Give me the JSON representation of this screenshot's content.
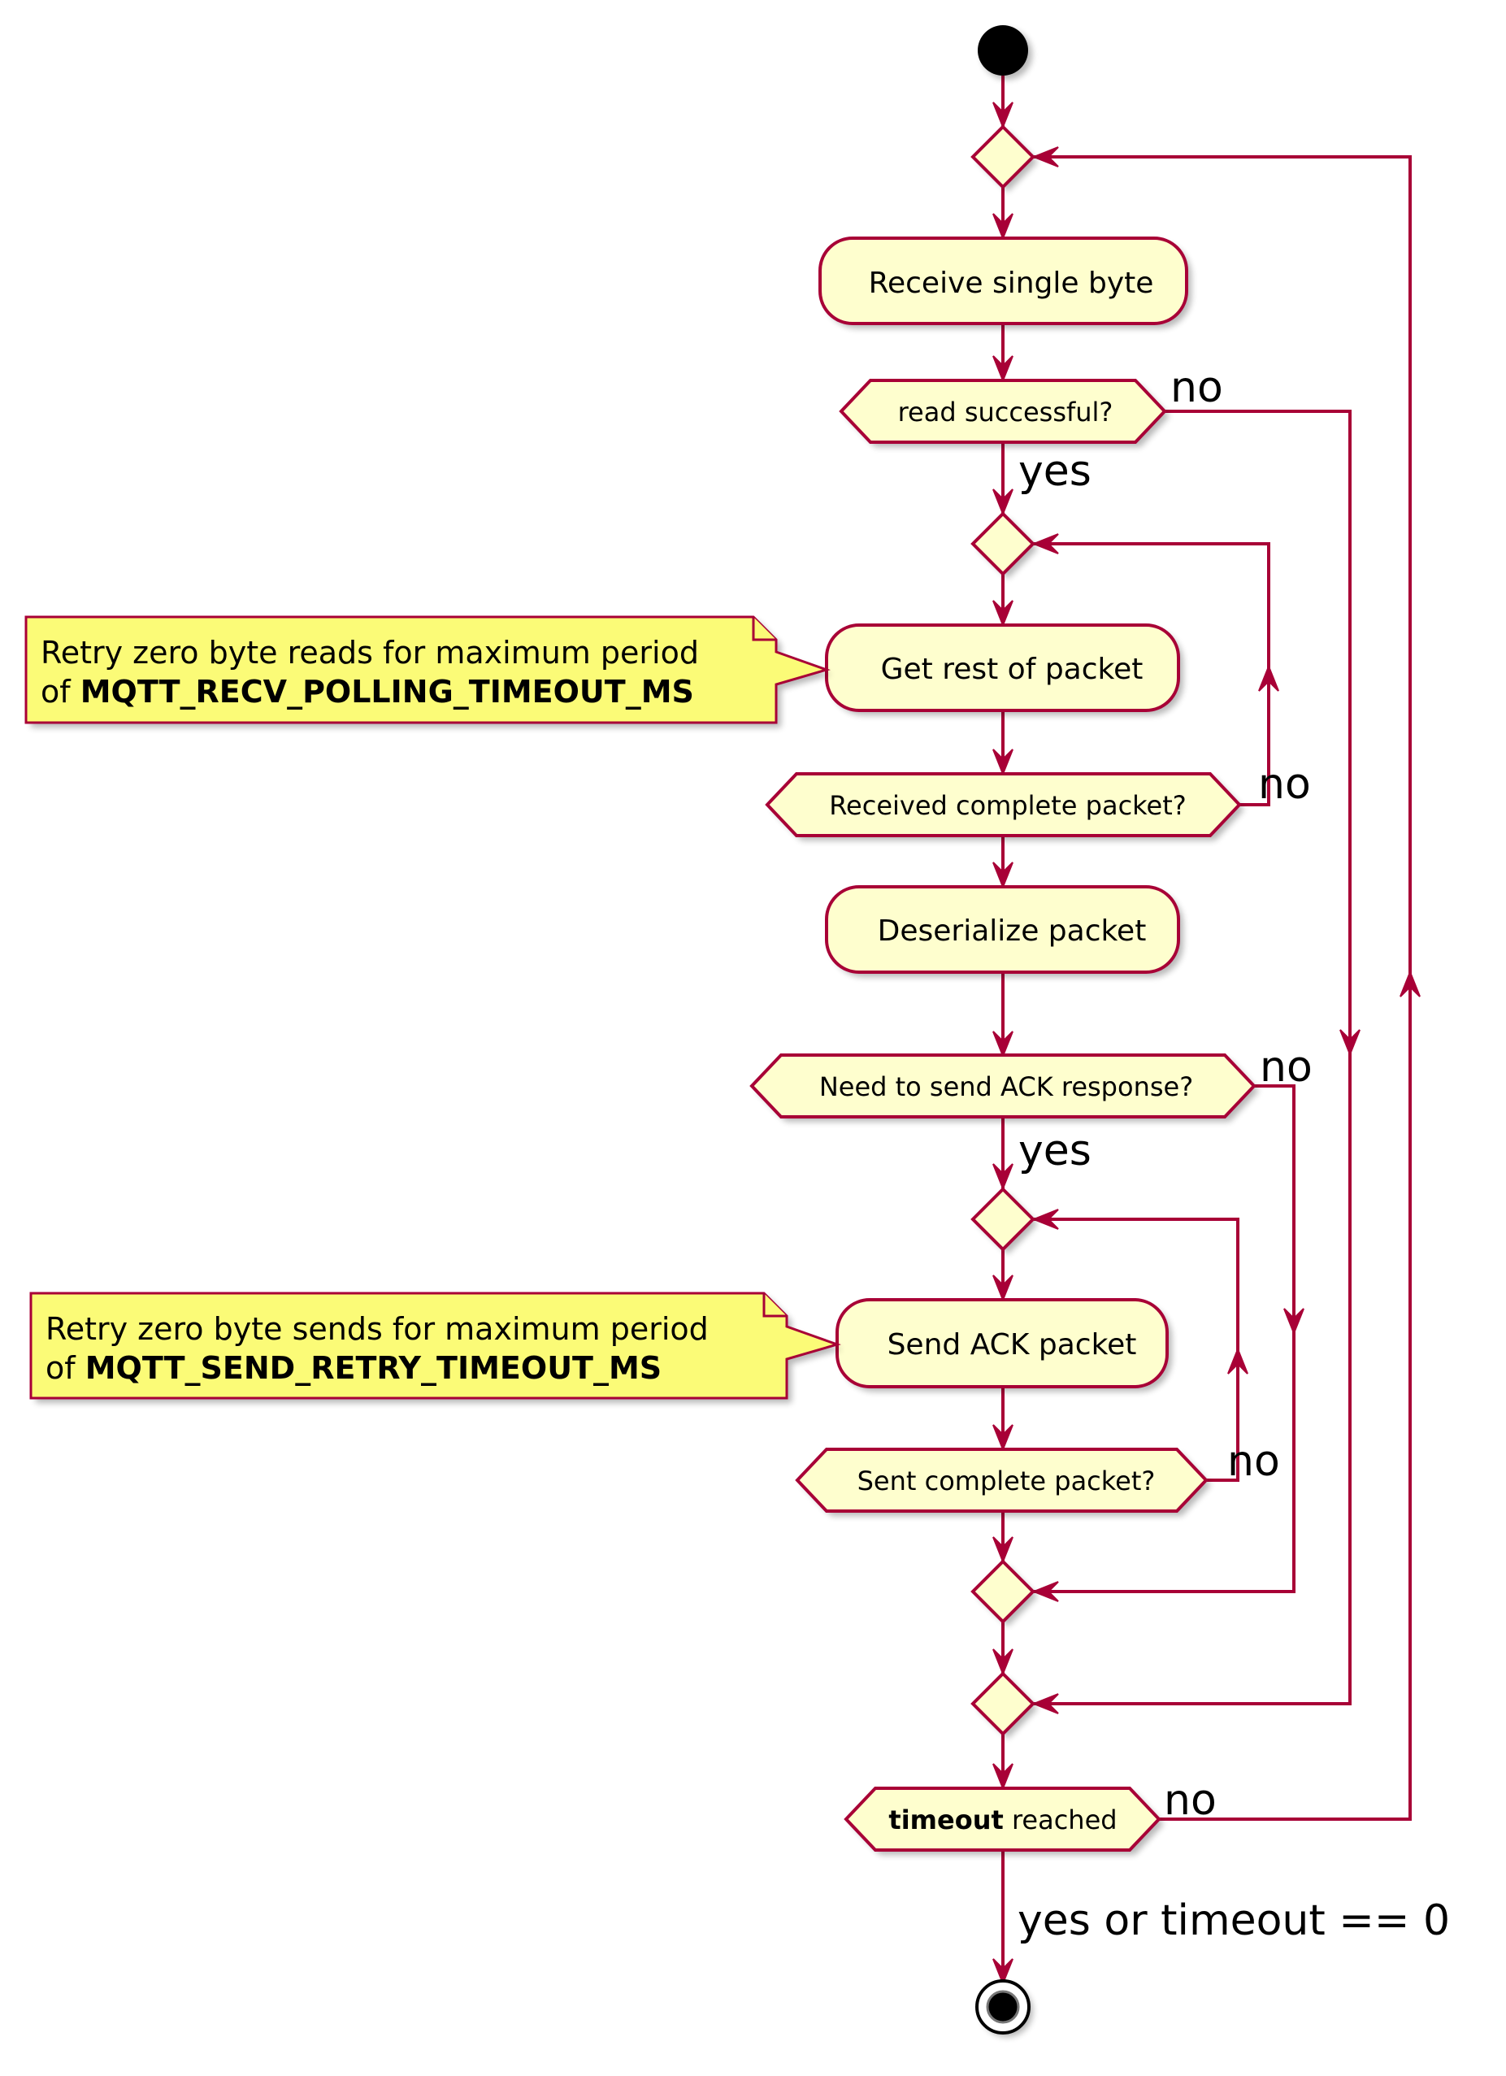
{
  "diagram": {
    "type": "activity-flowchart",
    "colors": {
      "line": "#A80036",
      "node_fill": "#FEFECE",
      "note_fill": "#FBFB77",
      "text": "#000000"
    },
    "nodes": {
      "start": {
        "kind": "start"
      },
      "merge_outer": {
        "kind": "merge"
      },
      "receive_byte": {
        "kind": "activity",
        "label": "Receive single byte"
      },
      "read_successful": {
        "kind": "decision",
        "label": "read successful?"
      },
      "merge_recv_loop": {
        "kind": "merge"
      },
      "get_rest": {
        "kind": "activity",
        "label": "Get rest of packet"
      },
      "received_complete": {
        "kind": "decision",
        "label": "Received complete packet?"
      },
      "deserialize": {
        "kind": "activity",
        "label": "Deserialize packet"
      },
      "need_ack": {
        "kind": "decision",
        "label": "Need to send ACK response?"
      },
      "merge_send_loop": {
        "kind": "merge"
      },
      "send_ack": {
        "kind": "activity",
        "label": "Send ACK packet"
      },
      "sent_complete": {
        "kind": "decision",
        "label": "Sent complete packet?"
      },
      "merge_ack": {
        "kind": "merge"
      },
      "merge_read": {
        "kind": "merge"
      },
      "timeout_reached": {
        "kind": "decision",
        "label_bold": "timeout",
        "label_rest": " reached"
      },
      "end": {
        "kind": "end"
      }
    },
    "edge_labels": {
      "read_no": "no",
      "read_yes": "yes",
      "recv_no": "no",
      "ack_no": "no",
      "ack_yes": "yes",
      "sent_no": "no",
      "timeout_no": "no",
      "timeout_yes": "yes or timeout == 0"
    },
    "notes": [
      {
        "line1": "Retry zero byte reads for maximum period",
        "line2_prefix": "of ",
        "line2_bold": "MQTT_RECV_POLLING_TIMEOUT_MS",
        "attached_to": "get_rest"
      },
      {
        "line1": "Retry zero byte sends for maximum period",
        "line2_prefix": "of ",
        "line2_bold": "MQTT_SEND_RETRY_TIMEOUT_MS",
        "attached_to": "send_ack"
      }
    ]
  }
}
